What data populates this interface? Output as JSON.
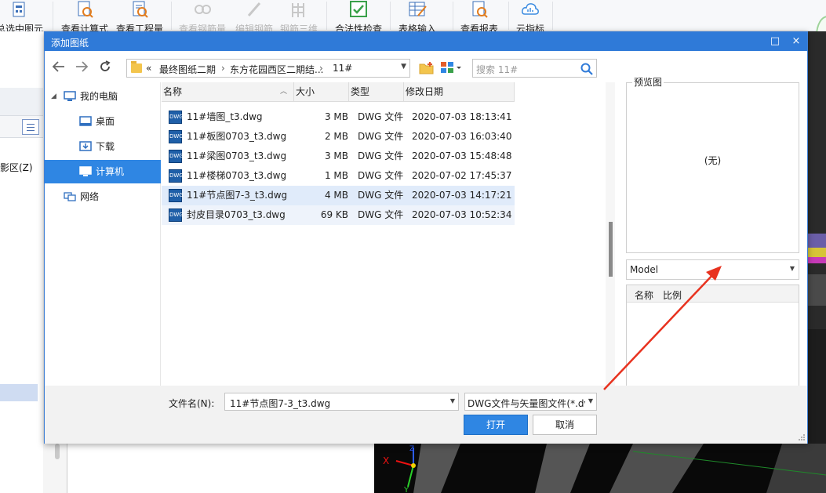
{
  "ribbon": {
    "buttons": [
      {
        "label": "总选中图元",
        "icon": "summary-icon",
        "disabled": false
      },
      {
        "label": "查看计算式",
        "icon": "view-formula-icon",
        "disabled": false
      },
      {
        "label": "查看工程量",
        "icon": "view-quantity-icon",
        "disabled": false
      },
      {
        "label": "查看钢筋量",
        "icon": "view-rebar-icon",
        "disabled": true
      },
      {
        "label": "编辑钢筋",
        "icon": "edit-rebar-icon",
        "disabled": true
      },
      {
        "label": "钢筋三维",
        "icon": "rebar-3d-icon",
        "disabled": true
      },
      {
        "label": "合法性检查",
        "icon": "check-icon",
        "disabled": false
      },
      {
        "label": "表格输入",
        "icon": "table-input-icon",
        "disabled": false
      },
      {
        "label": "查看报表",
        "icon": "report-icon",
        "disabled": false
      },
      {
        "label": "云指标",
        "icon": "cloud-icon",
        "disabled": false
      }
    ]
  },
  "background": {
    "left_label": "影区(Z)"
  },
  "dialog": {
    "title": "添加图纸",
    "maximize_glyph": "□",
    "close_glyph": "×",
    "address": {
      "prefix": "«",
      "segments": [
        "最终图纸二期",
        "东方花园西区二期结...",
        "11#"
      ],
      "separator": "›"
    },
    "search": {
      "placeholder": "搜索 11#"
    },
    "nav": [
      {
        "label": "我的电脑",
        "icon": "computer-icon",
        "expanded": true,
        "selected": false
      },
      {
        "label": "桌面",
        "icon": "desktop-icon",
        "selected": false
      },
      {
        "label": "下载",
        "icon": "download-icon",
        "selected": false
      },
      {
        "label": "计算机",
        "icon": "computer-icon",
        "selected": true
      },
      {
        "label": "网络",
        "icon": "network-icon",
        "selected": false
      }
    ],
    "columns": [
      "名称",
      "大小",
      "类型",
      "修改日期"
    ],
    "files": [
      {
        "name": "11#墙图_t3.dwg",
        "size": "3 MB",
        "type": "DWG 文件",
        "date": "2020-07-03 18:13:41",
        "selected": false
      },
      {
        "name": "11#板图0703_t3.dwg",
        "size": "2 MB",
        "type": "DWG 文件",
        "date": "2020-07-03 16:03:40",
        "selected": false
      },
      {
        "name": "11#梁图0703_t3.dwg",
        "size": "3 MB",
        "type": "DWG 文件",
        "date": "2020-07-03 15:48:48",
        "selected": false
      },
      {
        "name": "11#楼梯0703_t3.dwg",
        "size": "1 MB",
        "type": "DWG 文件",
        "date": "2020-07-02 17:45:37",
        "selected": false
      },
      {
        "name": "11#节点图7-3_t3.dwg",
        "size": "4 MB",
        "type": "DWG 文件",
        "date": "2020-07-03 14:17:21",
        "selected": true
      },
      {
        "name": "封皮目录0703_t3.dwg",
        "size": "69 KB",
        "type": "DWG 文件",
        "date": "2020-07-03 10:52:34",
        "selected": false
      }
    ],
    "file_icon_text": "DWG",
    "preview": {
      "label": "预览图",
      "empty": "(无)"
    },
    "model_select": {
      "value": "Model"
    },
    "layout_list": {
      "col_name": "名称",
      "col_scale": "比例"
    },
    "filename_label": "文件名(N):",
    "filename_value": "11#节点图7-3_t3.dwg",
    "filetype_value": "DWG文件与矢量图文件(*.dv",
    "open_label": "打开",
    "cancel_label": "取消"
  },
  "colors": {
    "accent": "#2f86e3",
    "titlebar": "#2f7ad8",
    "selected_row": "#e0ebfa",
    "annotation_arrow": "#e8321f"
  }
}
